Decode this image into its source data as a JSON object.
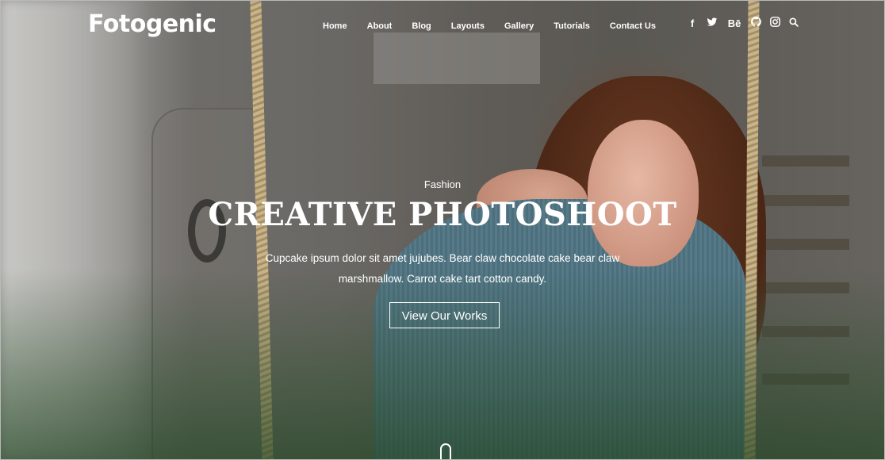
{
  "brand": {
    "logo_text": "Fotogenic"
  },
  "nav": {
    "items": [
      {
        "label": "Home"
      },
      {
        "label": "About"
      },
      {
        "label": "Blog"
      },
      {
        "label": "Layouts"
      },
      {
        "label": "Gallery"
      },
      {
        "label": "Tutorials"
      },
      {
        "label": "Contact Us"
      }
    ]
  },
  "social": {
    "icons": [
      {
        "name": "facebook-icon",
        "glyph": "f"
      },
      {
        "name": "twitter-icon",
        "glyph": "t"
      },
      {
        "name": "behance-icon",
        "glyph": "Bē"
      },
      {
        "name": "github-icon",
        "glyph": "●"
      },
      {
        "name": "instagram-icon",
        "glyph": "◙"
      },
      {
        "name": "search-icon",
        "glyph": "⚲"
      }
    ]
  },
  "hero": {
    "category": "Fashion",
    "title": "CREATIVE PHOTOSHOOT",
    "description_line1": "Cupcake ipsum dolor sit amet jujubes. Bear claw chocolate cake bear claw",
    "description_line2": "marshmallow. Carrot cake tart cotton candy.",
    "cta_label": "View Our Works"
  },
  "colors": {
    "text": "#ffffff",
    "sweater": "#567a88",
    "hair": "#5a2f1c"
  }
}
